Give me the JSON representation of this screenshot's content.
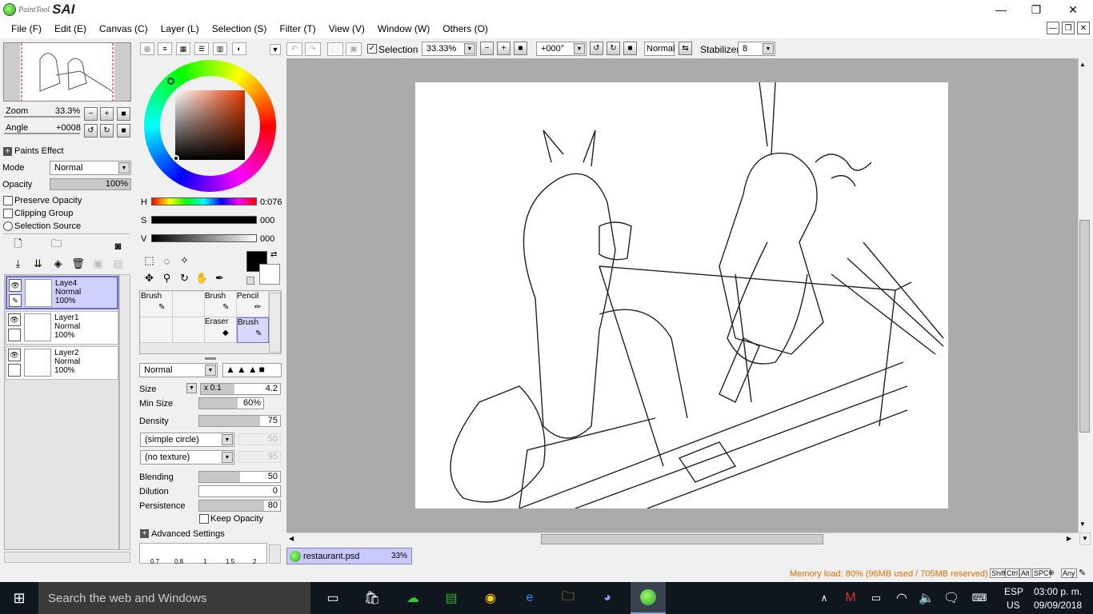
{
  "app": {
    "logo_small": "PaintTool",
    "logo_big": "SAI"
  },
  "window": {
    "minimize": "—",
    "restore": "❐",
    "close": "✕"
  },
  "menu": [
    "File (F)",
    "Edit (E)",
    "Canvas (C)",
    "Layer (L)",
    "Selection (S)",
    "Filter (T)",
    "View (V)",
    "Window (W)",
    "Others (O)"
  ],
  "navigator": {
    "zoom_label": "Zoom",
    "zoom_value": "33.3%",
    "angle_label": "Angle",
    "angle_value": "+0008"
  },
  "layer_panel": {
    "paints_effect": "Paints Effect",
    "mode_label": "Mode",
    "mode_value": "Normal",
    "opacity_label": "Opacity",
    "opacity_value": "100%",
    "opacity_fraction": 1.0,
    "preserve_opacity": "Preserve Opacity",
    "clipping_group": "Clipping Group",
    "selection_source": "Selection Source",
    "layers": [
      {
        "name": "Laye4",
        "mode": "Normal",
        "opacity": "100%",
        "selected": true
      },
      {
        "name": "Layer1",
        "mode": "Normal",
        "opacity": "100%",
        "selected": false
      },
      {
        "name": "Layer2",
        "mode": "Normal",
        "opacity": "100%",
        "selected": false
      }
    ]
  },
  "color": {
    "h_label": "H",
    "h_value": "0:076",
    "s_label": "S",
    "s_value": "000",
    "v_label": "V",
    "v_value": "000",
    "primary": "#000000",
    "secondary": "#ffffff"
  },
  "brushes": [
    {
      "label": "Brush",
      "selected": false
    },
    {
      "label": "",
      "selected": false
    },
    {
      "label": "Brush",
      "selected": false
    },
    {
      "label": "Pencil",
      "selected": false
    },
    {
      "label": "",
      "selected": false
    },
    {
      "label": "",
      "selected": false
    },
    {
      "label": "Eraser",
      "selected": false
    },
    {
      "label": "Brush",
      "selected": true
    }
  ],
  "brush_settings": {
    "blend_mode": "Normal",
    "size_label": "Size",
    "size_mult": "x 0.1",
    "size_value": "4.2",
    "size_fraction": 0.42,
    "min_size_label": "Min Size",
    "min_size_value": "60%",
    "min_size_fraction": 0.6,
    "density_label": "Density",
    "density_value": "75",
    "density_fraction": 0.75,
    "shape": "(simple circle)",
    "shape_value": "50",
    "texture": "(no texture)",
    "texture_value": "95",
    "blending_label": "Blending",
    "blending_value": "50",
    "blending_fraction": 0.5,
    "dilution_label": "Dilution",
    "dilution_value": "0",
    "dilution_fraction": 0.0,
    "persistence_label": "Persistence",
    "persistence_value": "80",
    "persistence_fraction": 0.8,
    "keep_opacity": "Keep Opacity",
    "advanced": "Advanced Settings",
    "presets": [
      "0.7",
      "0.8",
      "1",
      "1.5",
      "2"
    ]
  },
  "toolbar": {
    "selection_label": "Selection",
    "zoom_value": "33.33%",
    "angle_value": "+000°",
    "mode_value": "Normal",
    "stabilizer_label": "Stabilizer",
    "stabilizer_value": "8"
  },
  "document": {
    "tab_name": "restaurant.psd",
    "tab_zoom": "33%"
  },
  "status": {
    "memory": "Memory load: 80% (96MB used / 705MB reserved)",
    "keys": [
      "Shift",
      "Ctrl",
      "Alt",
      "SPC",
      "Any"
    ]
  },
  "taskbar": {
    "search": "Search the web and Windows",
    "lang": "ESP",
    "region": "US",
    "time": "03:00 p. m.",
    "date": "09/09/2018"
  },
  "colors": {
    "accent_select": "#d0d0ff",
    "memory_text": "#e07000",
    "taskbar": "#10161d"
  }
}
